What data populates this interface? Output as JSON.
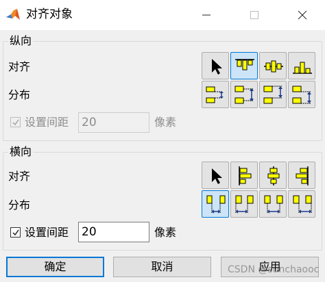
{
  "window": {
    "title": "对齐对象",
    "icon": "matlab-logo-icon",
    "controls": [
      "minimize-icon",
      "maximize-icon",
      "close-icon"
    ]
  },
  "vertical": {
    "label": "纵向",
    "align_label": "对齐",
    "distribute_label": "分布",
    "align_buttons": [
      {
        "icon": "pointer-icon",
        "active": false
      },
      {
        "icon": "align-top-icon",
        "active": true
      },
      {
        "icon": "align-middle-icon",
        "active": false
      },
      {
        "icon": "align-bottom-icon",
        "active": false
      }
    ],
    "distribute_buttons": [
      {
        "icon": "distribute-vertical-top-icon",
        "active": false
      },
      {
        "icon": "distribute-vertical-center-icon",
        "active": false
      },
      {
        "icon": "distribute-vertical-bottom-icon",
        "active": false
      },
      {
        "icon": "distribute-vertical-gap-icon",
        "active": false
      }
    ],
    "set_spacing_label": "设置间距",
    "set_spacing_checked": true,
    "set_spacing_enabled": false,
    "spacing_value": "20",
    "unit_label": "像素"
  },
  "horizontal": {
    "label": "横向",
    "align_label": "对齐",
    "distribute_label": "分布",
    "align_buttons": [
      {
        "icon": "pointer-icon",
        "active": false
      },
      {
        "icon": "align-left-icon",
        "active": false
      },
      {
        "icon": "align-center-icon",
        "active": false
      },
      {
        "icon": "align-right-icon",
        "active": false
      }
    ],
    "distribute_buttons": [
      {
        "icon": "distribute-horizontal-gap-icon",
        "active": true
      },
      {
        "icon": "distribute-horizontal-left-icon",
        "active": false
      },
      {
        "icon": "distribute-horizontal-center-icon",
        "active": false
      },
      {
        "icon": "distribute-horizontal-right-icon",
        "active": false
      }
    ],
    "set_spacing_label": "设置间距",
    "set_spacing_checked": true,
    "set_spacing_enabled": true,
    "spacing_value": "20",
    "unit_label": "像素"
  },
  "buttons": {
    "ok": "确定",
    "cancel": "取消",
    "apply": "应用"
  },
  "watermark": "CSDN @sunchaooc",
  "colors": {
    "accent": "#0078d7",
    "icon_fill": "#ffff00",
    "icon_stroke": "#000000",
    "arrow": "#1a3a8c"
  }
}
